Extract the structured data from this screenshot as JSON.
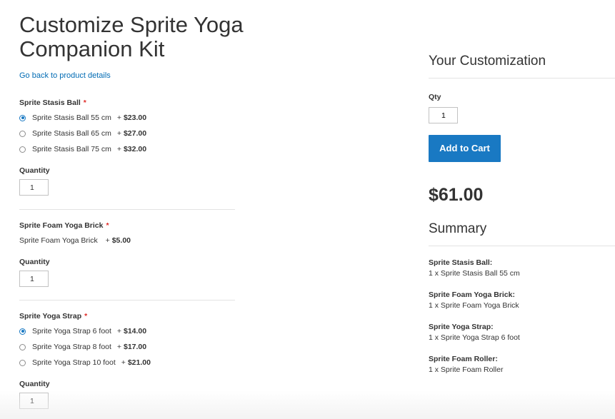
{
  "page": {
    "title": "Customize Sprite Yoga Companion Kit",
    "back_link": "Go back to product details"
  },
  "groups": [
    {
      "label": "Sprite Stasis Ball",
      "required_mark": "*",
      "options": [
        {
          "name": "Sprite Stasis Ball 55 cm",
          "price_prefix": "+",
          "price": "$23.00",
          "selected": true
        },
        {
          "name": "Sprite Stasis Ball 65 cm",
          "price_prefix": "+",
          "price": "$27.00",
          "selected": false
        },
        {
          "name": "Sprite Stasis Ball 75 cm",
          "price_prefix": "+",
          "price": "$32.00",
          "selected": false
        }
      ],
      "quantity_label": "Quantity",
      "quantity": "1"
    },
    {
      "label": "Sprite Foam Yoga Brick",
      "required_mark": "*",
      "options": [
        {
          "name": "Sprite Foam Yoga Brick",
          "price_prefix": "+",
          "price": "$5.00"
        }
      ],
      "quantity_label": "Quantity",
      "quantity": "1"
    },
    {
      "label": "Sprite Yoga Strap",
      "required_mark": "*",
      "options": [
        {
          "name": "Sprite Yoga Strap 6 foot",
          "price_prefix": "+",
          "price": "$14.00",
          "selected": true
        },
        {
          "name": "Sprite Yoga Strap 8 foot",
          "price_prefix": "+",
          "price": "$17.00",
          "selected": false
        },
        {
          "name": "Sprite Yoga Strap 10 foot",
          "price_prefix": "+",
          "price": "$21.00",
          "selected": false
        }
      ],
      "quantity_label": "Quantity",
      "quantity": "1"
    }
  ],
  "sidebar": {
    "customization_title": "Your Customization",
    "qty_label": "Qty",
    "qty_value": "1",
    "add_to_cart": "Add to Cart",
    "price": "$61.00",
    "summary_title": "Summary",
    "summary": [
      {
        "name": "Sprite Stasis Ball:",
        "value": "1 x Sprite Stasis Ball 55 cm"
      },
      {
        "name": "Sprite Foam Yoga Brick:",
        "value": "1 x Sprite Foam Yoga Brick"
      },
      {
        "name": "Sprite Yoga Strap:",
        "value": "1 x Sprite Yoga Strap 6 foot"
      },
      {
        "name": "Sprite Foam Roller:",
        "value": "1 x Sprite Foam Roller"
      }
    ]
  },
  "colors": {
    "accent": "#1979c3",
    "link": "#006bb4",
    "required": "#e02b27"
  }
}
